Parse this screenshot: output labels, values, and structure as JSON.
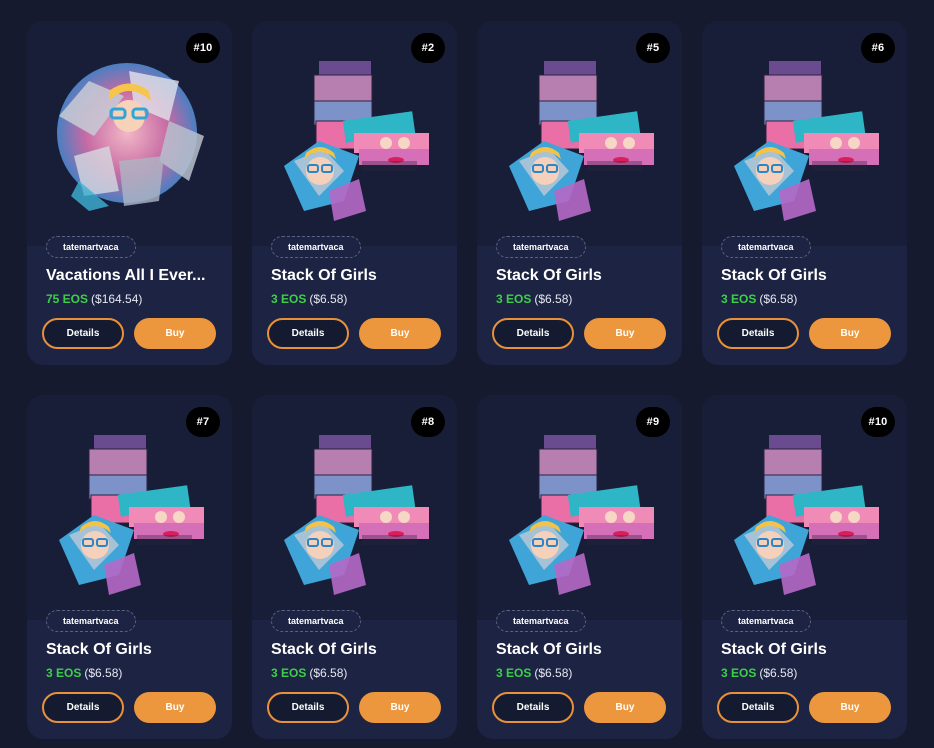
{
  "cards": [
    {
      "edition": "#10",
      "creator": "tatemartvaca",
      "title": "Vacations All I Ever...",
      "price_eos": "75 EOS",
      "price_usd": "($164.54)",
      "details_label": "Details",
      "buy_label": "Buy",
      "art": "sphere"
    },
    {
      "edition": "#2",
      "creator": "tatemartvaca",
      "title": "Stack Of Girls",
      "price_eos": "3 EOS",
      "price_usd": "($6.58)",
      "details_label": "Details",
      "buy_label": "Buy",
      "art": "stack"
    },
    {
      "edition": "#5",
      "creator": "tatemartvaca",
      "title": "Stack Of Girls",
      "price_eos": "3 EOS",
      "price_usd": "($6.58)",
      "details_label": "Details",
      "buy_label": "Buy",
      "art": "stack"
    },
    {
      "edition": "#6",
      "creator": "tatemartvaca",
      "title": "Stack Of Girls",
      "price_eos": "3 EOS",
      "price_usd": "($6.58)",
      "details_label": "Details",
      "buy_label": "Buy",
      "art": "stack"
    },
    {
      "edition": "#7",
      "creator": "tatemartvaca",
      "title": "Stack Of Girls",
      "price_eos": "3 EOS",
      "price_usd": "($6.58)",
      "details_label": "Details",
      "buy_label": "Buy",
      "art": "stack"
    },
    {
      "edition": "#8",
      "creator": "tatemartvaca",
      "title": "Stack Of Girls",
      "price_eos": "3 EOS",
      "price_usd": "($6.58)",
      "details_label": "Details",
      "buy_label": "Buy",
      "art": "stack"
    },
    {
      "edition": "#9",
      "creator": "tatemartvaca",
      "title": "Stack Of Girls",
      "price_eos": "3 EOS",
      "price_usd": "($6.58)",
      "details_label": "Details",
      "buy_label": "Buy",
      "art": "stack"
    },
    {
      "edition": "#10",
      "creator": "tatemartvaca",
      "title": "Stack Of Girls",
      "price_eos": "3 EOS",
      "price_usd": "($6.58)",
      "details_label": "Details",
      "buy_label": "Buy",
      "art": "stack"
    }
  ],
  "colors": {
    "background": "#151a2e",
    "card": "#1d2342",
    "accent": "#ec973e",
    "eos_green": "#3ecf4a"
  }
}
